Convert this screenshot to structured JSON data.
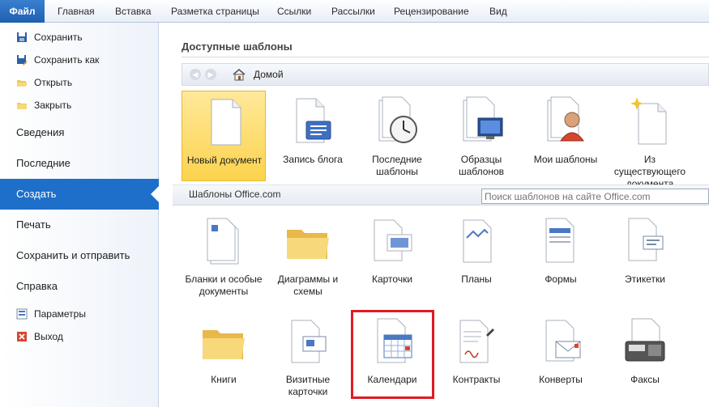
{
  "ribbon": {
    "tabs": [
      "Файл",
      "Главная",
      "Вставка",
      "Разметка страницы",
      "Ссылки",
      "Рассылки",
      "Рецензирование",
      "Вид"
    ]
  },
  "sidebar": {
    "small_top": [
      {
        "label": "Сохранить",
        "icon": "save-icon"
      },
      {
        "label": "Сохранить как",
        "icon": "save-as-icon"
      },
      {
        "label": "Открыть",
        "icon": "open-folder-icon"
      },
      {
        "label": "Закрыть",
        "icon": "close-folder-icon"
      }
    ],
    "big": [
      {
        "label": "Сведения"
      },
      {
        "label": "Последние"
      },
      {
        "label": "Создать",
        "active": true
      },
      {
        "label": "Печать"
      },
      {
        "label": "Сохранить и отправить"
      },
      {
        "label": "Справка"
      }
    ],
    "small_bottom": [
      {
        "label": "Параметры",
        "icon": "options-icon"
      },
      {
        "label": "Выход",
        "icon": "exit-icon"
      }
    ]
  },
  "main": {
    "section_title": "Доступные шаблоны",
    "nav": {
      "back": "◀",
      "forward": "▶",
      "home_label": "Домой"
    },
    "top_templates": [
      {
        "label": "Новый документ",
        "icon": "blank-document-icon",
        "selected": true
      },
      {
        "label": "Запись блога",
        "icon": "blog-post-icon"
      },
      {
        "label": "Последние шаблоны",
        "icon": "recent-templates-icon"
      },
      {
        "label": "Образцы шаблонов",
        "icon": "sample-templates-icon"
      },
      {
        "label": "Мои шаблоны",
        "icon": "my-templates-icon"
      },
      {
        "label": "Из существующего документа",
        "icon": "from-existing-icon"
      }
    ],
    "office_section_title": "Шаблоны Office.com",
    "search_placeholder": "Поиск шаблонов на сайте Office.com",
    "office_row1": [
      {
        "label": "Бланки и особые документы",
        "icon": "forms-documents-icon"
      },
      {
        "label": "Диаграммы и схемы",
        "icon": "folder-icon"
      },
      {
        "label": "Карточки",
        "icon": "cards-icon"
      },
      {
        "label": "Планы",
        "icon": "plans-icon"
      },
      {
        "label": "Формы",
        "icon": "forms-icon"
      },
      {
        "label": "Этикетки",
        "icon": "labels-icon"
      }
    ],
    "office_row2": [
      {
        "label": "Книги",
        "icon": "folder-icon"
      },
      {
        "label": "Визитные карточки",
        "icon": "business-cards-icon"
      },
      {
        "label": "Календари",
        "icon": "calendar-icon",
        "highlighted": true
      },
      {
        "label": "Контракты",
        "icon": "contracts-icon"
      },
      {
        "label": "Конверты",
        "icon": "envelope-icon"
      },
      {
        "label": "Факсы",
        "icon": "fax-icon"
      }
    ]
  },
  "colors": {
    "accent": "#1e6fc9",
    "selected_tile": "#fcd34d",
    "highlight_border": "#e11b22"
  }
}
